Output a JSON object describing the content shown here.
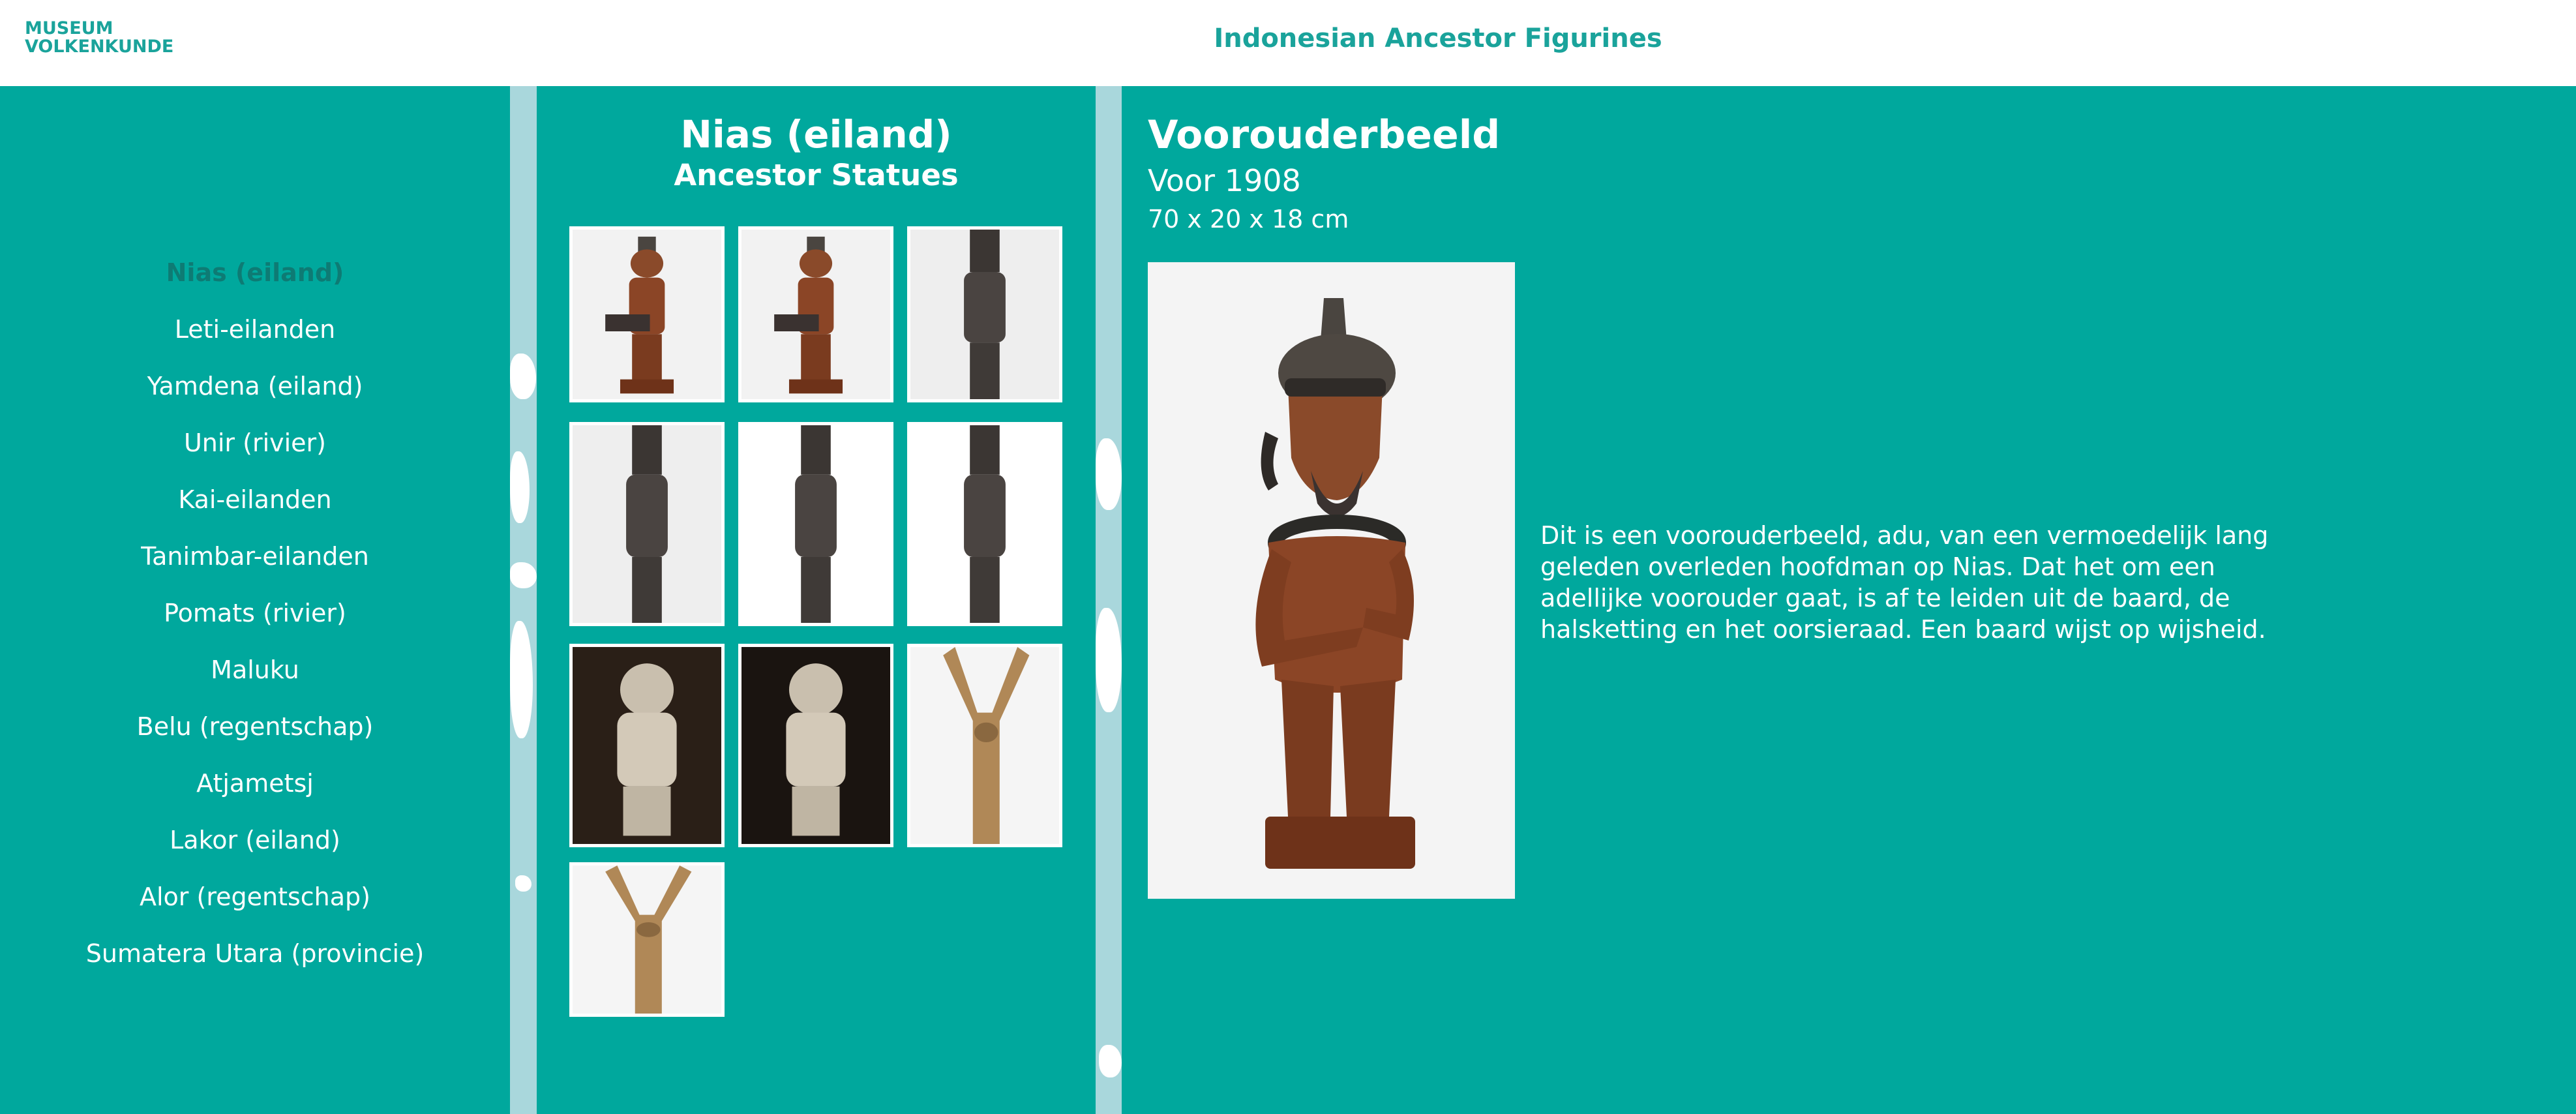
{
  "header": {
    "logo_line1": "MUSEUM",
    "logo_line2": "VOLKENKUNDE",
    "title": "Indonesian Ancestor Figurines"
  },
  "sidebar": {
    "items": [
      {
        "label": "Nias (eiland)",
        "active": true
      },
      {
        "label": "Leti-eilanden"
      },
      {
        "label": "Yamdena (eiland)"
      },
      {
        "label": "Unir (rivier)"
      },
      {
        "label": "Kai-eilanden"
      },
      {
        "label": "Tanimbar-eilanden"
      },
      {
        "label": "Pomats (rivier)"
      },
      {
        "label": "Maluku"
      },
      {
        "label": "Belu (regentschap)"
      },
      {
        "label": "Atjametsj"
      },
      {
        "label": "Lakor (eiland)"
      },
      {
        "label": "Alor (regentschap)"
      },
      {
        "label": "Sumatera Utara (provincie)"
      }
    ]
  },
  "gallery": {
    "title": "Nias (eiland)",
    "subtitle": "Ancestor Statues",
    "thumbnails": [
      {
        "type": "seated-figure-brown",
        "bg": "#f2f2f2"
      },
      {
        "type": "seated-figure-brown",
        "bg": "#f2f2f2"
      },
      {
        "type": "standing-figure-dark",
        "bg": "#eeeeee"
      },
      {
        "type": "standing-figure-dark",
        "bg": "#eeeeee"
      },
      {
        "type": "standing-figure-dark",
        "bg": "#ffffff"
      },
      {
        "type": "standing-figure-dark",
        "bg": "#ffffff"
      },
      {
        "type": "stone-figure",
        "bg": "#2a1f17"
      },
      {
        "type": "stone-figure",
        "bg": "#1a1410"
      },
      {
        "type": "forked-wood",
        "bg": "#f5f5f5"
      },
      {
        "type": "forked-wood",
        "bg": "#f5f5f5"
      }
    ]
  },
  "detail": {
    "title": "Voorouderbeeld",
    "date": "Voor 1908",
    "dimensions": "70 x 20 x 18 cm",
    "description": "Dit is een voorouderbeeld, adu, van een vermoedelijk lang geleden overleden hoofdman op Nias. Dat het om een adellijke voorouder gaat, is af te leiden uit de baard, de halsketting en het oorsieraad. Een baard wijst op wijsheid."
  },
  "colors": {
    "teal": "#00a89d",
    "header_text": "#1aa39b",
    "active_item": "#0e7b74",
    "map_water": "#a9d7dc"
  }
}
